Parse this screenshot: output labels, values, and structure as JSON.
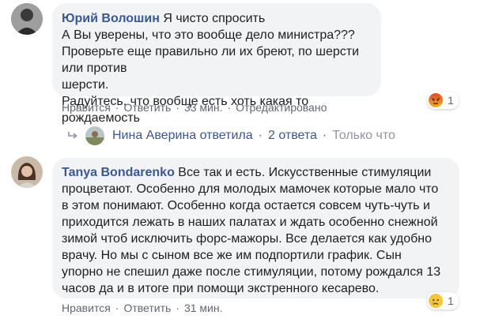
{
  "comments": [
    {
      "author": "Юрий Волошин",
      "lines": [
        "Я чисто спросить",
        "А Вы уверены, что это вообще дело министра???",
        "Проверьте еще правильно ли их бреют, по шерсти или против",
        "шерсти.",
        "Радуйтесь, что вообще есть хоть какая то рождаемость"
      ],
      "actions": {
        "like": "Нравится",
        "reply": "Ответить",
        "time": "33 мин.",
        "edited": "Отредактировано"
      },
      "reaction": {
        "type": "angry",
        "count": "1"
      }
    },
    {
      "author": "Tanya Bondarenko",
      "lines": [
        "Все так и есть. Искусственные стимуляции",
        "процветают. Особенно для молодых мамочек которые мало что",
        "в этом понимают. Особенно когда остается совсем чуть-чуть и",
        "приходится лежать в наших палатах и ждать особенно снежной",
        "зимой чтоб исключить форс-мажоры. Все делается как удобно",
        "врачу. Но мы с сыном все же им подпортили график. Сын",
        "упорно не спешил даже после стимуляции, потому рождался 13",
        "часов да и в итоге при помощи экстренного кесарево."
      ],
      "actions": {
        "like": "Нравится",
        "reply": "Ответить",
        "time": "31 мин."
      },
      "reaction": {
        "type": "sad",
        "count": "1"
      }
    }
  ],
  "reply": {
    "text": "Нина Аверина ответила",
    "count": "2 ответа",
    "time": "Только что"
  },
  "colors": {
    "link": "#385898",
    "bubble": "#f2f3f5",
    "muted": "#606770"
  }
}
